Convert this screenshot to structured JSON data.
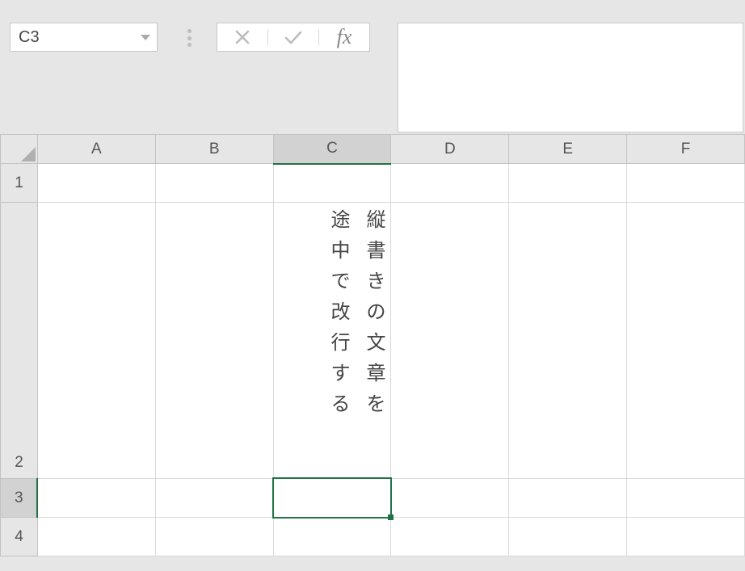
{
  "namebox": {
    "value": "C3"
  },
  "formula_bar": {
    "value": ""
  },
  "columns": [
    "A",
    "B",
    "C",
    "D",
    "E",
    "F"
  ],
  "rows": [
    "1",
    "2",
    "3",
    "4"
  ],
  "selected_col": "C",
  "selected_row": "3",
  "cell_c2": {
    "col1": [
      "縦",
      "書",
      "き",
      "の",
      "文",
      "章",
      "を"
    ],
    "col2": [
      "途",
      "中",
      "で",
      "改",
      "行",
      "す",
      "る"
    ]
  },
  "col_widths": {
    "rowhead": 46,
    "A": 146,
    "B": 146,
    "C": 146,
    "D": 146,
    "E": 146,
    "F": 146
  },
  "row_heights": {
    "colhead": 36,
    "1": 48,
    "2": 342,
    "3": 48,
    "4": 48
  }
}
